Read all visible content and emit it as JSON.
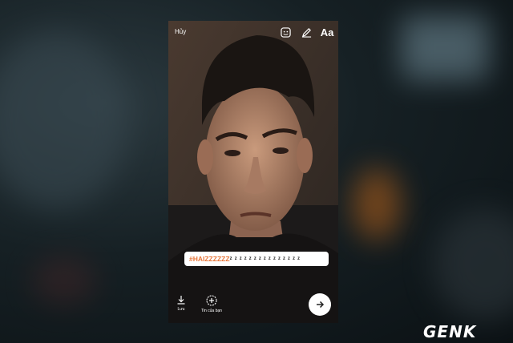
{
  "story_editor": {
    "cancel_label": "Hủy",
    "text_tool_label": "Aa",
    "hashtag_sticker": {
      "hashtag": "#HAIZZZZZZ",
      "trailing_text": "ᶻ ᶻ ᶻ ᶻ ᶻ ᶻ ᶻ ᶻ ᶻ ᶻ ᶻ ᶻ ᶻ ᶻ ᶻ"
    },
    "save_label": "Lưu",
    "your_story_label": "Tin của bạn",
    "icons": {
      "sticker": "sticker-icon",
      "draw": "pen-icon",
      "save": "download-icon",
      "story": "add-story-icon",
      "send": "arrow-right-icon"
    }
  },
  "watermark": {
    "logo_text": "GENK"
  }
}
